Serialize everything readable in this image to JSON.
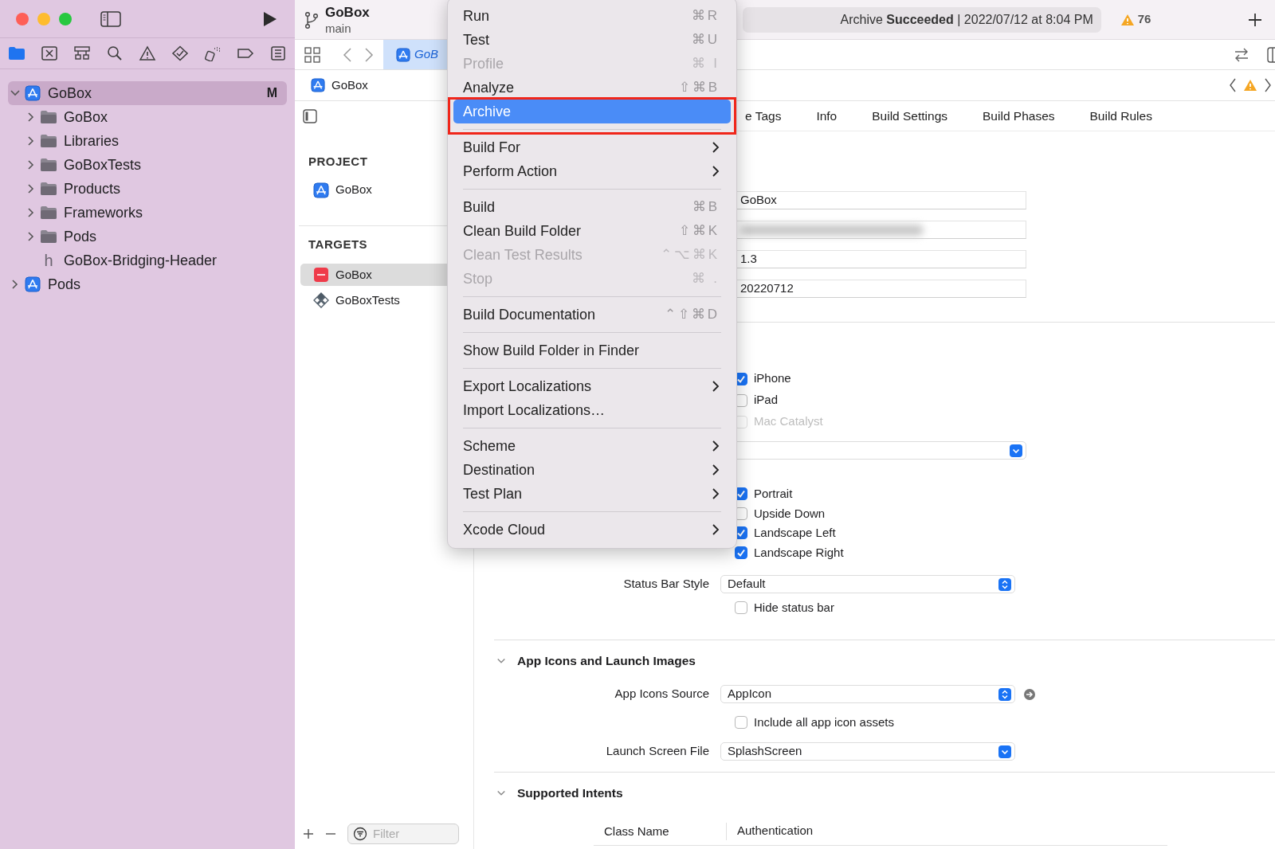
{
  "window_controls": [
    {
      "kind": "close"
    },
    {
      "kind": "minimize"
    },
    {
      "kind": "zoom"
    }
  ],
  "toolbar": {
    "scheme": "GoBox",
    "branch": "main",
    "status": "Archive **Succeeded** | 2022/07/12 at 8:04 PM",
    "warnings": "76"
  },
  "navigator_tabs": [
    {
      "selected": true
    },
    {
      "selected": false
    },
    {
      "selected": false
    },
    {
      "selected": false
    },
    {
      "selected": false
    },
    {
      "selected": false
    },
    {
      "selected": false
    },
    {
      "selected": false
    },
    {
      "selected": false
    }
  ],
  "navigator_tree": [
    {
      "label": "GoBox",
      "kind": "project",
      "badge": "M",
      "selected": true,
      "expanded": true,
      "children": [
        {
          "label": "GoBox",
          "kind": "folder",
          "selected": false,
          "expanded": false
        },
        {
          "label": "Libraries",
          "kind": "folder",
          "selected": false,
          "expanded": false
        },
        {
          "label": "GoBoxTests",
          "kind": "folder",
          "selected": false,
          "expanded": false
        },
        {
          "label": "Products",
          "kind": "folder",
          "selected": false,
          "expanded": false
        },
        {
          "label": "Frameworks",
          "kind": "folder",
          "selected": false,
          "expanded": false
        },
        {
          "label": "Pods",
          "kind": "folder",
          "selected": false,
          "expanded": false
        },
        {
          "label": "GoBox-Bridging-Header",
          "kind": "header",
          "glyph": "h",
          "selected": false
        }
      ]
    },
    {
      "label": "Pods",
      "kind": "project",
      "selected": false,
      "expanded": false
    }
  ],
  "editor_tabs": [
    {
      "label": "GoB",
      "selected": true
    }
  ],
  "jump_bar": {
    "label": "GoBox"
  },
  "project_list": {
    "project_heading": "PROJECT",
    "projects": [
      {
        "label": "GoBox",
        "kind": "app",
        "selected": false
      }
    ],
    "targets_heading": "TARGETS",
    "targets": [
      {
        "label": "GoBox",
        "kind": "app-target",
        "selected": true
      },
      {
        "label": "GoBoxTests",
        "kind": "test-target",
        "selected": false
      }
    ],
    "filter_placeholder": "Filter"
  },
  "settings_tabs": [
    {
      "label": "e Tags",
      "selected": false
    },
    {
      "label": "Info",
      "selected": false
    },
    {
      "label": "Build Settings",
      "selected": false
    },
    {
      "label": "Build Phases",
      "selected": false
    },
    {
      "label": "Build Rules",
      "selected": false
    }
  ],
  "identity_fields": [
    {
      "kind": "text",
      "value": "GoBox"
    },
    {
      "kind": "redacted"
    },
    {
      "kind": "text",
      "value": "1.3"
    },
    {
      "kind": "text",
      "value": "20220712"
    }
  ],
  "devices": [
    {
      "label": "iPhone",
      "checked": true,
      "disabled": false
    },
    {
      "label": "iPad",
      "checked": false,
      "disabled": false
    },
    {
      "label": "Mac Catalyst",
      "checked": false,
      "disabled": true
    }
  ],
  "device_popup": {
    "kind": "pulldown"
  },
  "orientations": [
    {
      "label": "Portrait",
      "checked": true,
      "disabled": false
    },
    {
      "label": "Upside Down",
      "checked": false,
      "disabled": false
    },
    {
      "label": "Landscape Left",
      "checked": true,
      "disabled": false
    },
    {
      "label": "Landscape Right",
      "checked": true,
      "disabled": false
    }
  ],
  "status_bar_style": {
    "label": "Status Bar Style",
    "value": "Default",
    "kind": "stepper"
  },
  "hide_status_bar": {
    "label": "Hide status bar",
    "checked": false,
    "disabled": false
  },
  "app_icons": {
    "title": "App Icons and Launch Images",
    "expanded": true,
    "source": {
      "label": "App Icons Source",
      "value": "AppIcon",
      "kind": "stepper"
    },
    "include_all": {
      "label": "Include all app icon assets",
      "checked": false,
      "disabled": false
    },
    "launch": {
      "label": "Launch Screen File",
      "value": "SplashScreen",
      "kind": "pulldown"
    }
  },
  "supported_intents": {
    "title": "Supported Intents",
    "expanded": true,
    "columns": [
      "Class Name",
      "Authentication"
    ]
  },
  "menu": {
    "items": [
      {
        "kind": "item",
        "label": "Run",
        "shortcut": "⌘R",
        "disabled": false,
        "selected": false,
        "framed": false
      },
      {
        "kind": "item",
        "label": "Test",
        "shortcut": "⌘U",
        "disabled": false,
        "selected": false,
        "framed": false
      },
      {
        "kind": "item",
        "label": "Profile",
        "shortcut": "⌘ I",
        "disabled": true,
        "selected": false,
        "framed": false
      },
      {
        "kind": "item",
        "label": "Analyze",
        "shortcut": "⇧⌘B",
        "disabled": false,
        "selected": false,
        "framed": false
      },
      {
        "kind": "item",
        "label": "Archive",
        "disabled": false,
        "selected": true,
        "framed": true
      },
      {
        "kind": "separator"
      },
      {
        "kind": "submenu",
        "label": "Build For",
        "disabled": false,
        "selected": false,
        "framed": false
      },
      {
        "kind": "submenu",
        "label": "Perform Action",
        "disabled": false,
        "selected": false,
        "framed": false
      },
      {
        "kind": "separator"
      },
      {
        "kind": "item",
        "label": "Build",
        "shortcut": "⌘B",
        "disabled": false,
        "selected": false,
        "framed": false
      },
      {
        "kind": "item",
        "label": "Clean Build Folder",
        "shortcut": "⇧⌘K",
        "disabled": false,
        "selected": false,
        "framed": false
      },
      {
        "kind": "item",
        "label": "Clean Test Results",
        "shortcut": "⌃⌥⌘K",
        "disabled": true,
        "selected": false,
        "framed": false
      },
      {
        "kind": "item",
        "label": "Stop",
        "shortcut": "⌘ .",
        "disabled": true,
        "selected": false,
        "framed": false
      },
      {
        "kind": "separator"
      },
      {
        "kind": "item",
        "label": "Build Documentation",
        "shortcut": "⌃⇧⌘D",
        "disabled": false,
        "selected": false,
        "framed": false
      },
      {
        "kind": "separator"
      },
      {
        "kind": "item",
        "label": "Show Build Folder in Finder",
        "disabled": false,
        "selected": false,
        "framed": false
      },
      {
        "kind": "separator"
      },
      {
        "kind": "submenu",
        "label": "Export Localizations",
        "disabled": false,
        "selected": false,
        "framed": false
      },
      {
        "kind": "item",
        "label": "Import Localizations…",
        "disabled": false,
        "selected": false,
        "framed": false
      },
      {
        "kind": "separator"
      },
      {
        "kind": "submenu",
        "label": "Scheme",
        "disabled": false,
        "selected": false,
        "framed": false
      },
      {
        "kind": "submenu",
        "label": "Destination",
        "disabled": false,
        "selected": false,
        "framed": false
      },
      {
        "kind": "submenu",
        "label": "Test Plan",
        "disabled": false,
        "selected": false,
        "framed": false
      },
      {
        "kind": "separator"
      },
      {
        "kind": "submenu",
        "label": "Xcode Cloud",
        "disabled": false,
        "selected": false,
        "framed": false
      }
    ]
  }
}
